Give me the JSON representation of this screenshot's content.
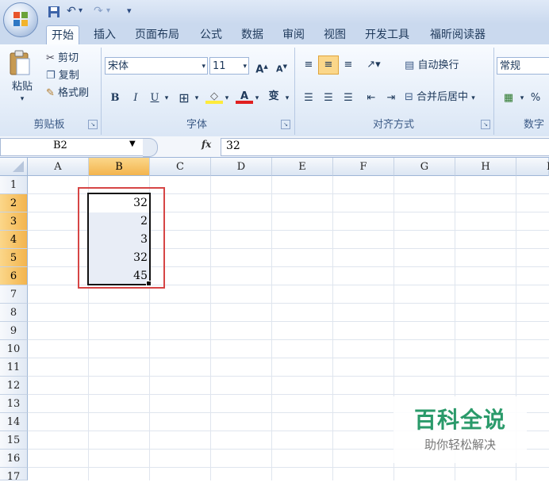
{
  "qat": {
    "office_button": "Office",
    "save": "save-icon",
    "undo": "↶",
    "redo": "↷",
    "customize": "▾"
  },
  "tabs": [
    "开始",
    "插入",
    "页面布局",
    "公式",
    "数据",
    "审阅",
    "视图",
    "开发工具",
    "福昕阅读器"
  ],
  "clipboard": {
    "paste": "粘贴",
    "cut": "剪切",
    "copy": "复制",
    "format_painter": "格式刷",
    "label": "剪贴板"
  },
  "font": {
    "name": "宋体",
    "size": "11",
    "grow": "A",
    "shrink": "A",
    "bold": "B",
    "italic": "I",
    "underline": "U",
    "border": "⊞",
    "fill": "◇",
    "color": "A",
    "phonetic": "变",
    "label": "字体"
  },
  "alignment": {
    "wrap": "自动换行",
    "merge": "合并后居中",
    "label": "对齐方式"
  },
  "number": {
    "format": "常规",
    "percent": "%",
    "label": "数字"
  },
  "formula_bar": {
    "name_box": "B2",
    "fx": "fx",
    "content": "32"
  },
  "columns": [
    "A",
    "B",
    "C",
    "D",
    "E",
    "F",
    "G",
    "H",
    "I"
  ],
  "rows": [
    "1",
    "2",
    "3",
    "4",
    "5",
    "6",
    "7",
    "8",
    "9",
    "10",
    "11",
    "12",
    "13",
    "14",
    "15",
    "16",
    "17"
  ],
  "cells": {
    "B2": "32",
    "B3": "2",
    "B4": "3",
    "B5": "32",
    "B6": "45"
  },
  "watermark": {
    "title": "百科全说",
    "subtitle": "助你轻松解决"
  },
  "colors": {
    "selection_outline": "#d64545",
    "selected_header": "#f7c05e",
    "ribbon": "#dae6f5"
  }
}
